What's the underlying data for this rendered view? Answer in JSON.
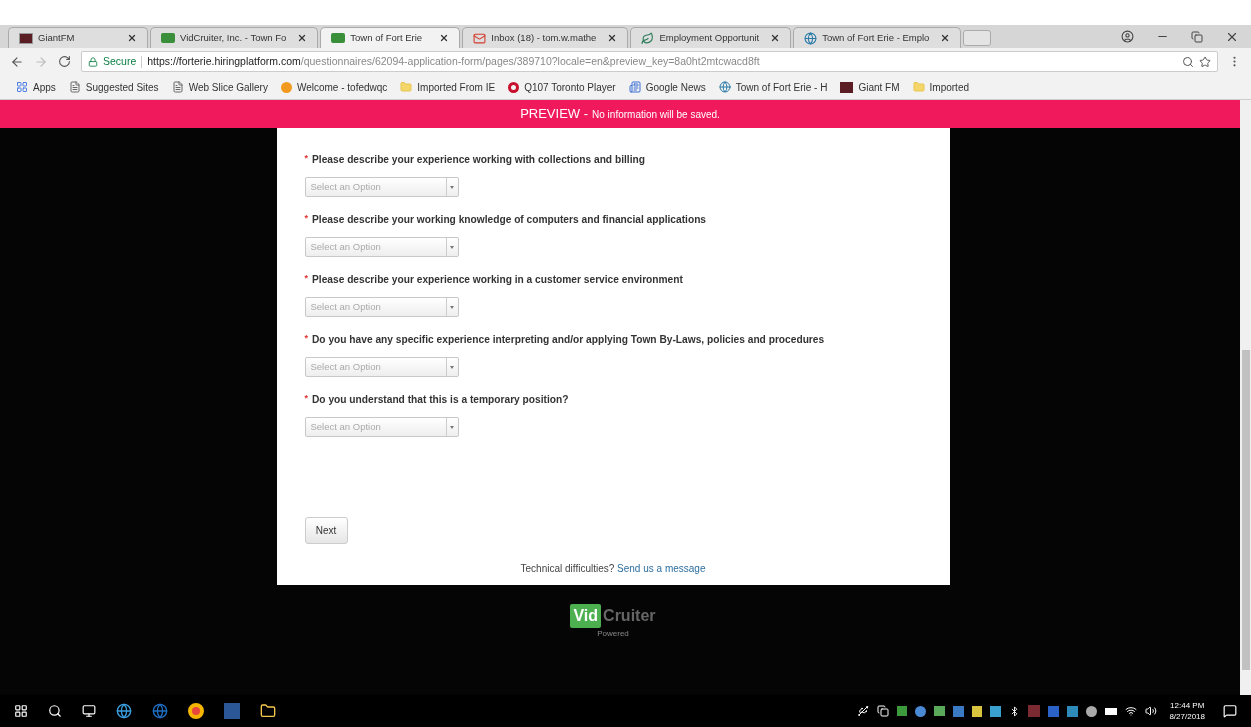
{
  "browser": {
    "tabs": [
      {
        "title": "GiantFM",
        "selected": false,
        "kind": "giant"
      },
      {
        "title": "VidCruiter, Inc. - Town Fo",
        "selected": false,
        "kind": "vid"
      },
      {
        "title": "Town of Fort Erie",
        "selected": true,
        "kind": "vid"
      },
      {
        "title": "Inbox (18) - tom.w.mathe",
        "selected": false,
        "kind": "mail"
      },
      {
        "title": "Employment Opportunit",
        "selected": false,
        "kind": "leaf"
      },
      {
        "title": "Town of Fort Erie - Emplo",
        "selected": false,
        "kind": "globe"
      }
    ],
    "secure_label": "Secure",
    "url_host": "https://forterie.hiringplatform.com",
    "url_path": "/questionnaires/62094-application-form/pages/389710?locale=en&preview_key=8a0ht2mtcwacd8ft",
    "bookmarks": [
      {
        "label": "Apps",
        "kind": "apps"
      },
      {
        "label": "Suggested Sites",
        "kind": "page"
      },
      {
        "label": "Web Slice Gallery",
        "kind": "page"
      },
      {
        "label": "Welcome - tofedwqc",
        "kind": "orange"
      },
      {
        "label": "Imported From IE",
        "kind": "folder"
      },
      {
        "label": "Q107 Toronto Player",
        "kind": "q"
      },
      {
        "label": "Google News",
        "kind": "news"
      },
      {
        "label": "Town of Fort Erie - H",
        "kind": "globe"
      },
      {
        "label": "Giant FM",
        "kind": "giant"
      },
      {
        "label": "Imported",
        "kind": "folder"
      }
    ]
  },
  "required_mark": "*",
  "banner": {
    "title": "PREVIEW -",
    "message": "No information will be saved."
  },
  "questions": [
    {
      "label": "Please describe your experience working with collections and billing",
      "required": true,
      "placeholder": "Select an Option"
    },
    {
      "label": "Please describe your working knowledge of computers and financial applications",
      "required": true,
      "placeholder": "Select an Option"
    },
    {
      "label": "Please describe your experience working in a customer service environment",
      "required": true,
      "placeholder": "Select an Option"
    },
    {
      "label": "Do you have any specific experience interpreting and/or applying Town By-Laws, policies and procedures",
      "required": true,
      "placeholder": "Select an Option"
    },
    {
      "label": "Do you understand that this is a temporary position?",
      "required": true,
      "placeholder": "Select an Option"
    }
  ],
  "next_button": "Next",
  "footer": {
    "text": "Technical difficulties?",
    "link": "Send us a message"
  },
  "logo": {
    "part_1": "Vid",
    "part_2": "Cruiter",
    "caption": "Powered"
  },
  "taskbar": {
    "time": "12:44 PM",
    "date": "8/27/2018"
  }
}
